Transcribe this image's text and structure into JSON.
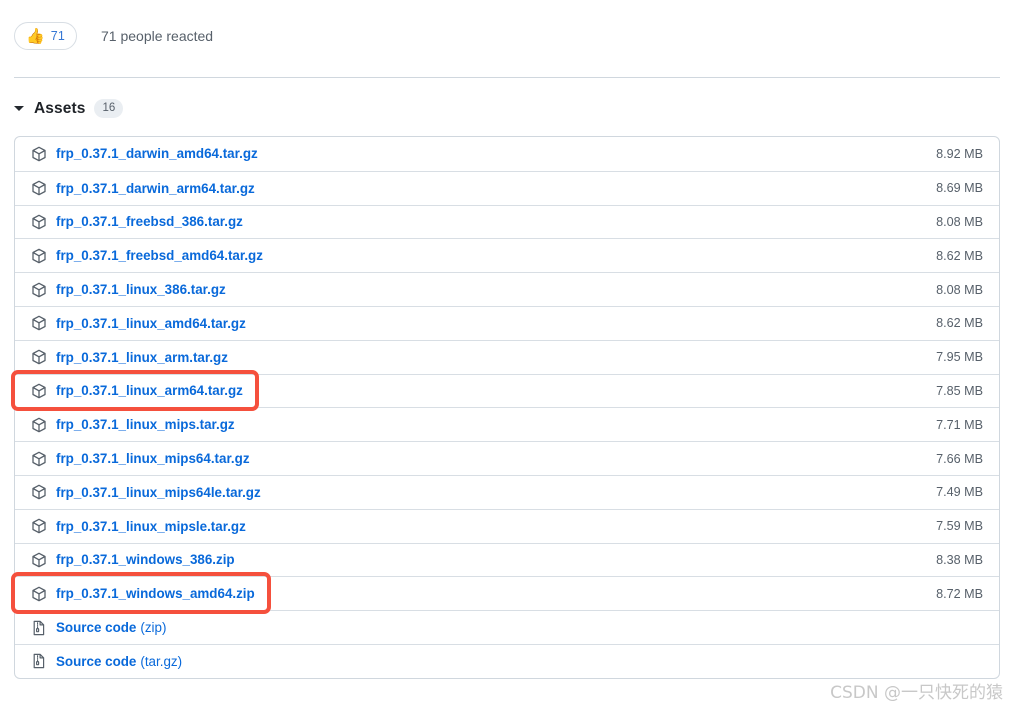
{
  "reactions": {
    "emoji": "thumbs-up-icon",
    "emoji_glyph": "👍",
    "count": "71",
    "summary": "71 people reacted"
  },
  "assets": {
    "caret_icon": "caret-down-icon",
    "title": "Assets",
    "count": "16",
    "rows": [
      {
        "icon": "package-icon",
        "name": "frp_0.37.1_darwin_amd64.tar.gz",
        "size": "8.92 MB"
      },
      {
        "icon": "package-icon",
        "name": "frp_0.37.1_darwin_arm64.tar.gz",
        "size": "8.69 MB"
      },
      {
        "icon": "package-icon",
        "name": "frp_0.37.1_freebsd_386.tar.gz",
        "size": "8.08 MB"
      },
      {
        "icon": "package-icon",
        "name": "frp_0.37.1_freebsd_amd64.tar.gz",
        "size": "8.62 MB"
      },
      {
        "icon": "package-icon",
        "name": "frp_0.37.1_linux_386.tar.gz",
        "size": "8.08 MB"
      },
      {
        "icon": "package-icon",
        "name": "frp_0.37.1_linux_amd64.tar.gz",
        "size": "8.62 MB"
      },
      {
        "icon": "package-icon",
        "name": "frp_0.37.1_linux_arm.tar.gz",
        "size": "7.95 MB"
      },
      {
        "icon": "package-icon",
        "name": "frp_0.37.1_linux_arm64.tar.gz",
        "size": "7.85 MB"
      },
      {
        "icon": "package-icon",
        "name": "frp_0.37.1_linux_mips.tar.gz",
        "size": "7.71 MB"
      },
      {
        "icon": "package-icon",
        "name": "frp_0.37.1_linux_mips64.tar.gz",
        "size": "7.66 MB"
      },
      {
        "icon": "package-icon",
        "name": "frp_0.37.1_linux_mips64le.tar.gz",
        "size": "7.49 MB"
      },
      {
        "icon": "package-icon",
        "name": "frp_0.37.1_linux_mipsle.tar.gz",
        "size": "7.59 MB"
      },
      {
        "icon": "package-icon",
        "name": "frp_0.37.1_windows_386.zip",
        "size": "8.38 MB"
      },
      {
        "icon": "package-icon",
        "name": "frp_0.37.1_windows_amd64.zip",
        "size": "8.72 MB"
      },
      {
        "icon": "file-zip-icon",
        "name": "Source code",
        "suffix": "(zip)",
        "size": ""
      },
      {
        "icon": "file-zip-icon",
        "name": "Source code",
        "suffix": "(tar.gz)",
        "size": ""
      }
    ]
  },
  "annotations": {
    "highlight_color": "#f5503d",
    "boxes": [
      {
        "label": "highlight-linux-arm64",
        "target_row": 7
      },
      {
        "label": "highlight-windows-amd64",
        "target_row": 13
      }
    ]
  },
  "watermark": {
    "text": "CSDN @一只快死的猿"
  }
}
